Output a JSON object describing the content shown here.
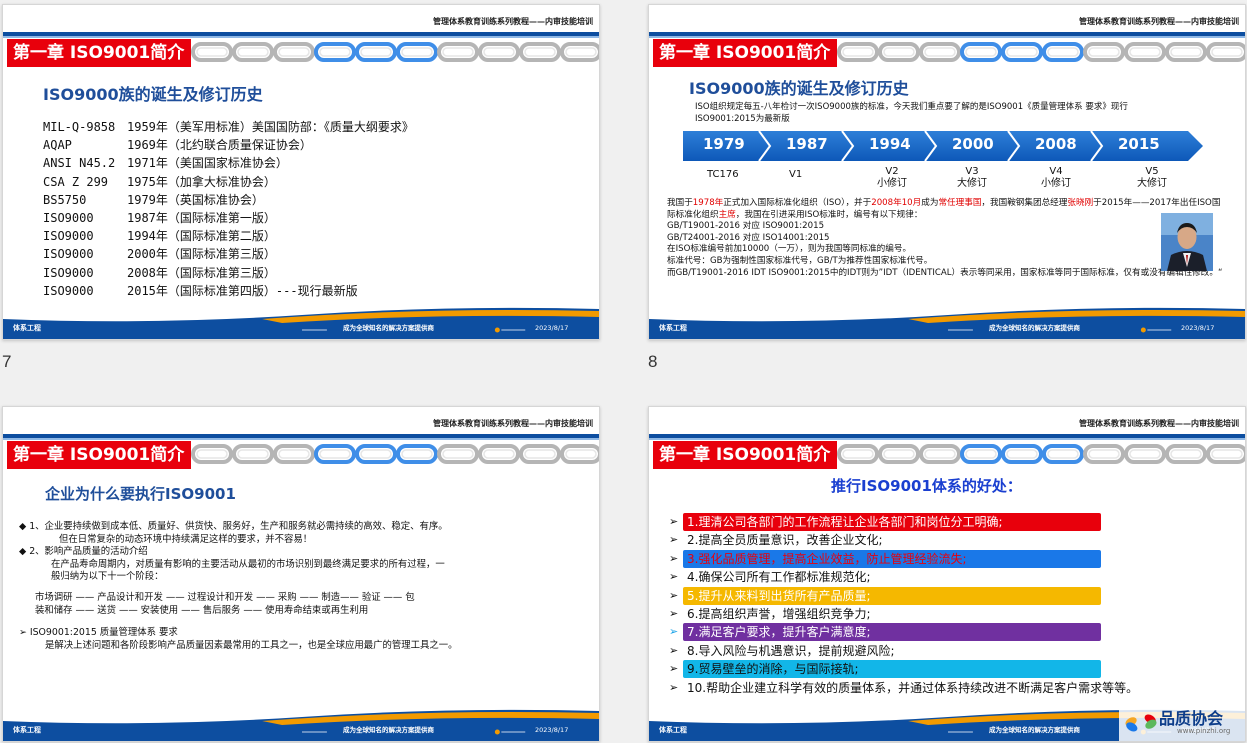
{
  "header": {
    "series_title": "管理体系教育训练系列教程——内审技能培训",
    "chapter_label": "第一章 ISO9001简介"
  },
  "footer": {
    "left": "体系工程",
    "slogan": "成为全球知名的解决方案提供商",
    "date": "2023/8/17"
  },
  "slide_numbers": [
    "7",
    "8"
  ],
  "slide7": {
    "title": "ISO9000族的诞生及修订历史",
    "rows": [
      {
        "code": "MIL-Q-9858",
        "text": "1959年（美军用标准）美国国防部：《质量大纲要求》"
      },
      {
        "code": "AQAP",
        "text": "1969年（北约联合质量保证协会）"
      },
      {
        "code": "ANSI N45.2",
        "text": "1971年（美国国家标准协会）"
      },
      {
        "code": "CSA Z 299",
        "text": "1975年（加拿大标准协会）"
      },
      {
        "code": "BS5750",
        "text": "1979年（英国标准协会）"
      },
      {
        "code": "ISO9000",
        "text": "1987年（国际标准第一版）"
      },
      {
        "code": "ISO9000",
        "text": "1994年（国际标准第二版）"
      },
      {
        "code": "ISO9000",
        "text": "2000年（国际标准第三版）"
      },
      {
        "code": "ISO9000",
        "text": "2008年（国际标准第三版）"
      },
      {
        "code": "ISO9000",
        "text": "2015年（国际标准第四版）---现行最新版"
      }
    ]
  },
  "slide8": {
    "title": "ISO9000族的诞生及修订历史",
    "intro": "ISO组织规定每五-八年检讨一次ISO9000族的标准，今天我们重点要了解的是ISO9001《质量管理体系 要求》现行ISO9001:2015为最新版",
    "timeline": [
      {
        "year": "1979",
        "label": "TC176"
      },
      {
        "year": "1987",
        "label": "V1"
      },
      {
        "year": "1994",
        "label": "V2\n小修订"
      },
      {
        "year": "2000",
        "label": "V3\n大修订"
      },
      {
        "year": "2008",
        "label": "V4\n小修订"
      },
      {
        "year": "2015",
        "label": "V5\n大修订"
      }
    ],
    "p1": {
      "a": "我国于",
      "b": "1978年",
      "c": "正式加入国际标准化组织（ISO），并于",
      "d": "2008年10月",
      "e": "成为",
      "f": "常任理事国",
      "g": "，我国鞍钢集团总经理",
      "h": "张晓刚",
      "i": "于2015年——2017年出任ISO国际标准化组织",
      "j": "主席",
      "k": "，我国在引进采用ISO标准时，编号有以下规律："
    },
    "lines": [
      "GB/T19001-2016 对应 ISO9001:2015",
      "GB/T24001-2016 对应 ISO14001:2015",
      "在ISO标准编号前加10000（一万），则为我国等同标准的编号。",
      "标准代号：GB为强制性国家标准代号，GB/T为推荐性国家标准代号。",
      "而GB/T19001-2016 IDT ISO9001:2015中的IDT则为”IDT（IDENTICAL）表示等同采用，国家标准等同于国际标准，仅有或没有编辑性修改。“"
    ]
  },
  "slide9": {
    "title": "企业为什么要执行ISO9001",
    "b1": "◆ 1、企业要持续做到成本低、质量好、供货快、服务好，生产和服务就必需持续的高效、稳定、有序。",
    "b1_cont": "但在日常复杂的动态环境中持续满足这样的要求，并不容易！",
    "b2": "◆ 2、影响产品质量的活动介绍",
    "b2_p1": "在产品寿命周期内，对质量有影响的主要活动从最初的市场识别到最终满足要求的所有过程，一",
    "b2_p2": "般归纳为以下十一个阶段：",
    "stages1": "市场调研 —— 产品设计和开发 —— 过程设计和开发 —— 采购 —— 制造—— 验证 —— 包",
    "stages2": "装和储存 —— 送货 —— 安装使用 —— 售后服务 —— 使用寿命结束或再生利用",
    "iso_head": "➢  ISO9001:2015 质量管理体系 要求",
    "iso_desc": "是解决上述问题和各阶段影响产品质量因素最常用的工具之一，也是全球应用最广的管理工具之一。"
  },
  "slide10": {
    "title": "推行ISO9001体系的好处：",
    "items": [
      {
        "text": "1.理清公司各部门的工作流程让企业各部门和岗位分工明确;",
        "bg": "#e8000c",
        "fg": "#ffffff",
        "arrow": "#111111"
      },
      {
        "text": "2.提高全员质量意识，改善企业文化;",
        "bg": "",
        "fg": "#111111",
        "arrow": "#111111"
      },
      {
        "text": "3.强化品质管理，提高企业效益，防止管理经验流失;",
        "bg": "#1a78e8",
        "fg": "#e8000c",
        "arrow": "#111111"
      },
      {
        "text": "4.确保公司所有工作都标准规范化;",
        "bg": "",
        "fg": "#111111",
        "arrow": "#111111"
      },
      {
        "text": "5.提升从来料到出货所有产品质量;",
        "bg": "#f5b800",
        "fg": "#ffffff",
        "arrow": "#111111"
      },
      {
        "text": "6.提高组织声誉，增强组织竞争力;",
        "bg": "",
        "fg": "#111111",
        "arrow": "#111111"
      },
      {
        "text": "7.满足客户要求，提升客户满意度;",
        "bg": "#7030a0",
        "fg": "#ffffff",
        "arrow": "#1aa3e8"
      },
      {
        "text": "8.导入风险与机遇意识，提前规避风险;",
        "bg": "",
        "fg": "#111111",
        "arrow": "#111111"
      },
      {
        "text": "9.贸易壁垒的消除，与国际接轨;",
        "bg": "#12b6e8",
        "fg": "#111111",
        "arrow": "#111111"
      },
      {
        "text": "10.帮助企业建立科学有效的质量体系，并通过体系持续改进不断满足客户需求等等。",
        "bg": "",
        "fg": "#111111",
        "arrow": "#111111"
      }
    ],
    "watermark": "品质协会",
    "watermark_url": "www.pinzhi.org"
  }
}
